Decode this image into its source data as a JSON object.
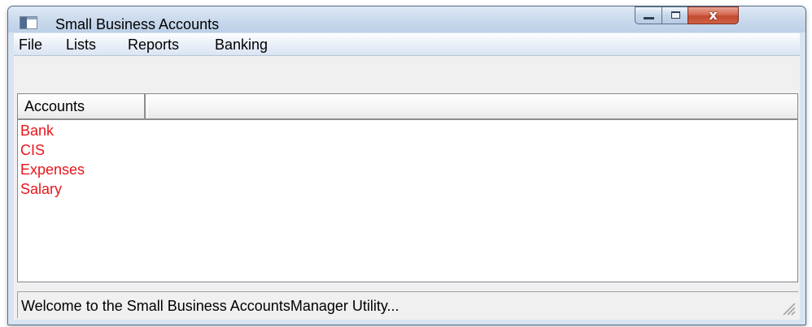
{
  "window": {
    "title": "Small Business Accounts",
    "caption_buttons": {
      "minimize": "minimize",
      "maximize": "maximize",
      "close": "x"
    }
  },
  "menu": {
    "items": [
      {
        "label": "File"
      },
      {
        "label": "Lists"
      },
      {
        "label": "Reports"
      },
      {
        "label": "Banking"
      }
    ]
  },
  "list": {
    "header": {
      "accounts": "Accounts"
    },
    "items": [
      {
        "label": "Bank"
      },
      {
        "label": "CIS"
      },
      {
        "label": "Expenses"
      },
      {
        "label": "Salary"
      }
    ],
    "item_color": "#e8161a"
  },
  "status": {
    "text": "Welcome to the Small Business AccountsManager Utility..."
  }
}
